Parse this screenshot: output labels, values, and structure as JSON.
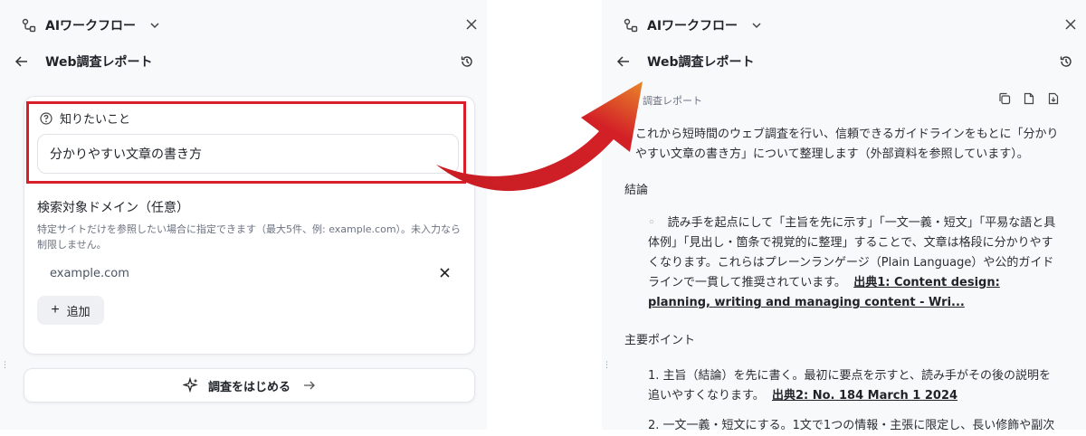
{
  "colors": {
    "highlight": "#d81f2a",
    "arrow": "#d32027"
  },
  "left": {
    "header_title": "AIワークフロー",
    "sub_title": "Web調査レポート",
    "question_label": "知りたいこと",
    "question_value": "分かりやすい文章の書き方",
    "domain_title": "検索対象ドメイン（任意）",
    "domain_help": "特定サイトだけを参照したい場合に指定できます（最大5件、例: example.com）。未入力なら制限しません。",
    "domain_value": "example.com",
    "add_label": "追加",
    "start_label": "調査をはじめる"
  },
  "right": {
    "header_title": "AIワークフロー",
    "sub_title": "Web調査レポート",
    "report_label": "調査レポート",
    "intro": "これから短時間のウェブ調査を行い、信頼できるガイドラインをもとに「分かりやすい文章の書き方」について整理します（外部資料を参照しています）。",
    "conclusion_heading": "結論",
    "conclusion_text": "読み手を起点にして「主旨を先に示す」「一文一義・短文」「平易な語と具体例」「見出し・箇条で視覚的に整理」することで、文章は格段に分かりやすくなります。これらはプレーンランゲージ（Plain Language）や公的ガイドラインで一貫して推奨されています。",
    "conclusion_cite": "出典1: Content design: planning, writing and managing content - Wri...",
    "points_heading": "主要ポイント",
    "point1_text": "1. 主旨（結論）を先に書く。最初に要点を示すと、読み手がその後の説明を追いやすくなります。",
    "point1_cite": "出典2: No. 184 March 1 2024",
    "point2_text": "2. 一文一義・短文にする。1文で1つの情報・主張に限定し、長い修飾や副次"
  }
}
